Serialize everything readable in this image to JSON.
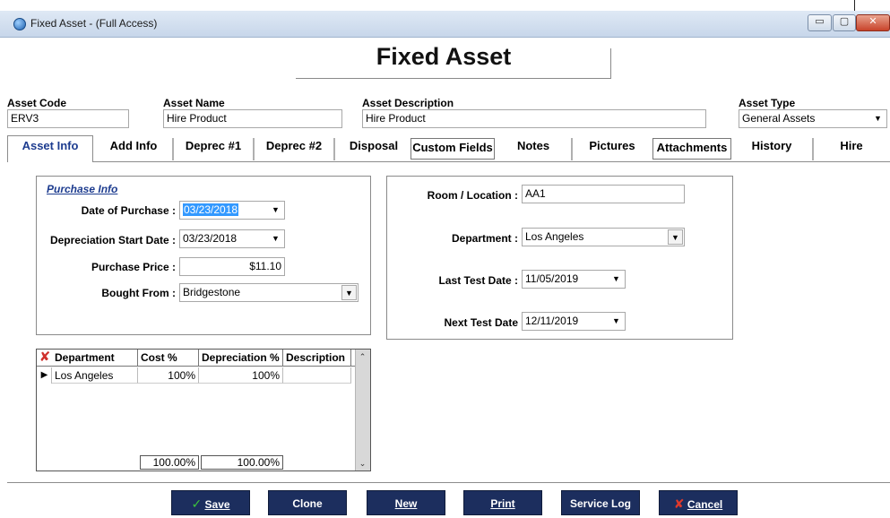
{
  "window": {
    "title": "Fixed Asset - (Full Access)",
    "min_glyph": "▭",
    "max_glyph": "▢",
    "close_glyph": "✕"
  },
  "page_title": "Fixed Asset",
  "header": {
    "asset_code": {
      "label": "Asset Code",
      "value": "ERV3"
    },
    "asset_name": {
      "label": "Asset Name",
      "value": "Hire Product"
    },
    "asset_description": {
      "label": "Asset Description",
      "value": "Hire Product"
    },
    "asset_type": {
      "label": "Asset Type",
      "value": "General Assets"
    }
  },
  "tabs": [
    {
      "label": "Asset Info",
      "active": true
    },
    {
      "label": "Add Info"
    },
    {
      "label": "Deprec #1"
    },
    {
      "label": "Deprec #2"
    },
    {
      "label": "Disposal"
    },
    {
      "label": "Custom Fields"
    },
    {
      "label": "Notes"
    },
    {
      "label": "Pictures"
    },
    {
      "label": "Attachments"
    },
    {
      "label": "History"
    },
    {
      "label": "Hire"
    }
  ],
  "purchase_info": {
    "section_title": "Purchase Info",
    "date_of_purchase": {
      "label": "Date of Purchase :",
      "value": "03/23/2018"
    },
    "depreciation_start_date": {
      "label": "Depreciation Start Date :",
      "value": "03/23/2018"
    },
    "purchase_price": {
      "label": "Purchase Price :",
      "value": "$11.10"
    },
    "bought_from": {
      "label": "Bought From :",
      "value": "Bridgestone"
    }
  },
  "location_info": {
    "room_location": {
      "label": "Room / Location :",
      "value": "AA1"
    },
    "department": {
      "label": "Department :",
      "value": "Los Angeles"
    },
    "last_test_date": {
      "label": "Last Test Date :",
      "value": "11/05/2019"
    },
    "next_test_date": {
      "label": "Next Test Date",
      "value": "12/11/2019"
    }
  },
  "department_grid": {
    "columns": [
      "Department",
      "Cost %",
      "Depreciation %",
      "Description"
    ],
    "rows": [
      {
        "department": "Los Angeles",
        "cost_pct": "100%",
        "depreciation_pct": "100%",
        "description": ""
      }
    ],
    "totals": {
      "cost_pct": "100.00%",
      "depreciation_pct": "100.00%"
    }
  },
  "buttons": {
    "save": "Save",
    "clone": "Clone",
    "new": "New",
    "print": "Print",
    "service_log": "Service Log",
    "cancel": "Cancel"
  },
  "colors": {
    "button_bg": "#1c2e5e",
    "active_tab_text": "#1d3c8f",
    "selection": "#3399ff",
    "save_check": "#3cc43c",
    "cancel_x": "#e0392b"
  }
}
